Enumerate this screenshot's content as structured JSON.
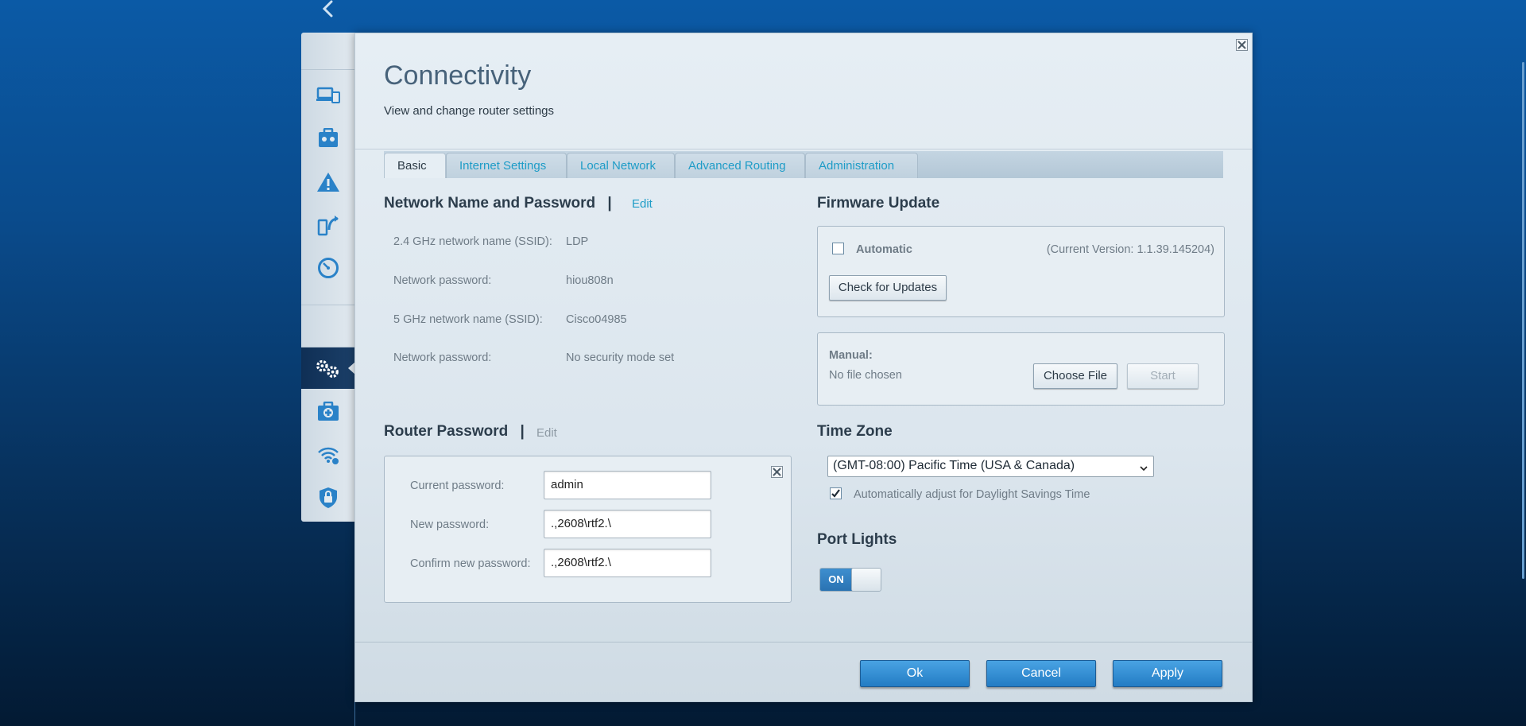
{
  "sidebar": {
    "icons": [
      "devices-icon",
      "parental-controls-icon",
      "troubleshooting-icon",
      "media-prioritization-icon",
      "speed-test-icon",
      "connectivity-icon",
      "external-storage-icon",
      "wireless-icon",
      "security-icon"
    ],
    "active": "connectivity-icon"
  },
  "dialog": {
    "title": "Connectivity",
    "subtitle": "View and change router settings"
  },
  "tabs": [
    {
      "label": "Basic",
      "active": true
    },
    {
      "label": "Internet Settings",
      "active": false
    },
    {
      "label": "Local Network",
      "active": false
    },
    {
      "label": "Advanced Routing",
      "active": false
    },
    {
      "label": "Administration",
      "active": false
    }
  ],
  "network": {
    "title": "Network Name and Password",
    "separator": "|",
    "edit_label": "Edit",
    "rows": [
      {
        "label": "2.4 GHz network name (SSID):",
        "value": "LDP"
      },
      {
        "label": "Network password:",
        "value": "hiou808n"
      },
      {
        "label": "5 GHz network name (SSID):",
        "value": "Cisco04985"
      },
      {
        "label": "Network password:",
        "value": "No security mode set"
      }
    ]
  },
  "router_password": {
    "title": "Router Password",
    "separator": "|",
    "edit_label": "Edit",
    "current_label": "Current password:",
    "current_value": "admin",
    "new_label": "New password:",
    "new_value": ".,2608\\rtf2.\\",
    "confirm_label": "Confirm new password:",
    "confirm_value": ".,2608\\rtf2.\\"
  },
  "firmware": {
    "title": "Firmware Update",
    "automatic_label": "Automatic",
    "automatic_checked": false,
    "current_version": "(Current Version: 1.1.39.145204)",
    "check_button": "Check for Updates",
    "manual_label": "Manual:",
    "no_file": "No file chosen",
    "choose_file": "Choose File",
    "start": "Start"
  },
  "timezone": {
    "title": "Time Zone",
    "selected": "(GMT-08:00) Pacific Time (USA & Canada)",
    "dst_label": "Automatically adjust for Daylight Savings Time",
    "dst_checked": true
  },
  "port_lights": {
    "title": "Port Lights",
    "state": "ON"
  },
  "footer": {
    "ok": "Ok",
    "cancel": "Cancel",
    "apply": "Apply"
  },
  "colors": {
    "accent": "#1e9cc7",
    "primary_button": "#2a80c8",
    "background": "#0a4b8c"
  }
}
